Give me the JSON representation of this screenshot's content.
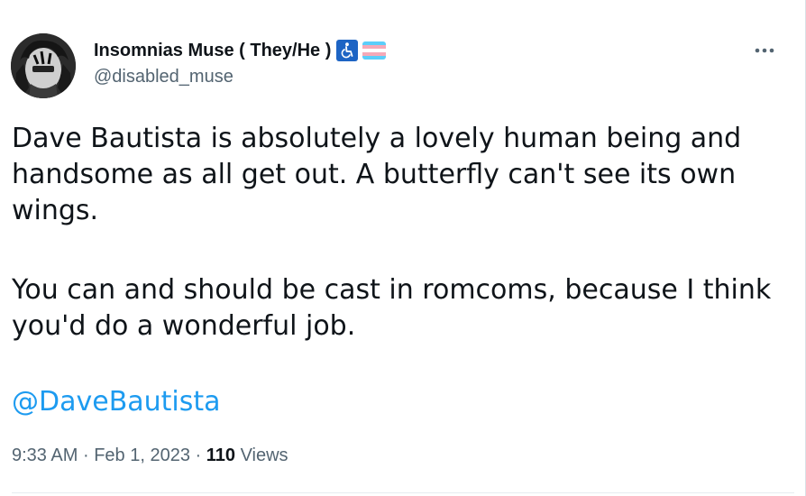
{
  "author": {
    "display_name": "Insomnias Muse ( They/He )",
    "handle": "@disabled_muse",
    "badges": [
      "accessibility-icon",
      "trans-flag-icon"
    ]
  },
  "tweet": {
    "paragraph_1": "Dave Bautista is absolutely a lovely human being and handsome as all get out. A butterfly can't see its own wings.",
    "paragraph_2": "You can and should be cast in romcoms, because I think you'd do a wonderful job.",
    "mention": "@DaveBautista"
  },
  "meta": {
    "time": "9:33 AM",
    "separator": "·",
    "date": "Feb 1, 2023",
    "views_count": "110",
    "views_label": "Views"
  },
  "actions": {
    "more_icon": "more-dots-icon"
  },
  "colors": {
    "text_primary": "#0f1419",
    "text_secondary": "#536471",
    "link": "#1d9bf0",
    "accessibility_badge": "#1d64c4",
    "trans_blue": "#5bcefa",
    "trans_pink": "#f5a9b8",
    "trans_white": "#ffffff"
  }
}
